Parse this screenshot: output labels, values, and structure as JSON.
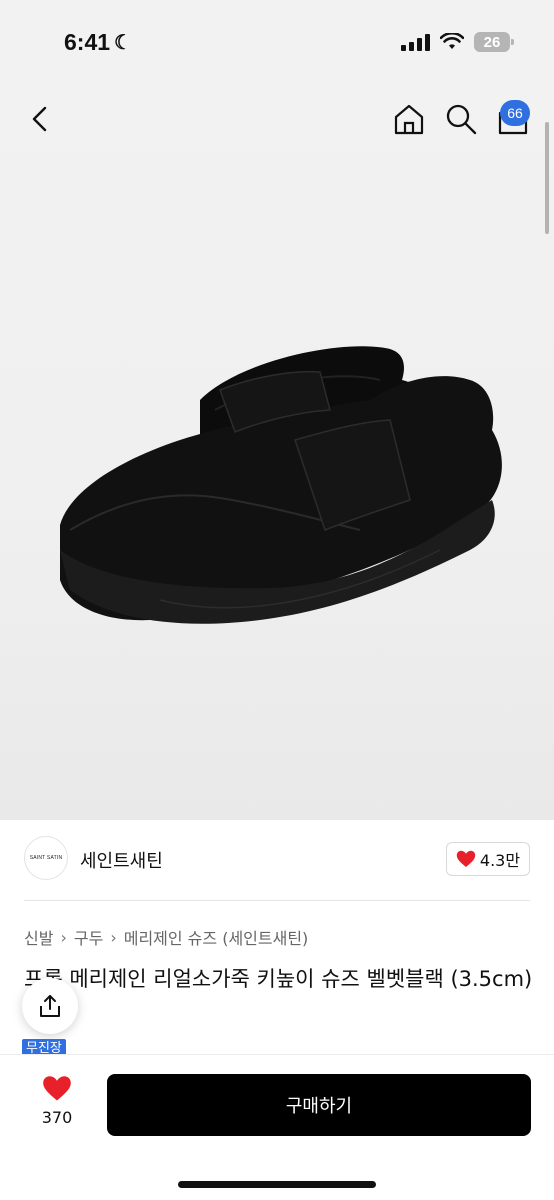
{
  "status_bar": {
    "time": "6:41",
    "battery": "26"
  },
  "nav": {
    "cart_count": "66",
    "icons": [
      "back-icon",
      "home-icon",
      "search-icon",
      "bag-icon"
    ]
  },
  "seller": {
    "logo_text": "SAINT SATIN",
    "name": "세인트새틴",
    "likes": "4.3만"
  },
  "breadcrumb": {
    "items": [
      "신발",
      "구두",
      "메리제인 슈즈 (세인트새틴)"
    ]
  },
  "product": {
    "title": "프롬 메리제인 리얼소가죽 키높이 슈즈 벨벳블랙 (3.5cm)",
    "tag": "무진장"
  },
  "bottom_bar": {
    "like_count": "370",
    "buy_label": "구매하기"
  },
  "colors": {
    "accent": "#2f6fe0",
    "heart": "#e8202a",
    "buy_button": "#000000"
  }
}
